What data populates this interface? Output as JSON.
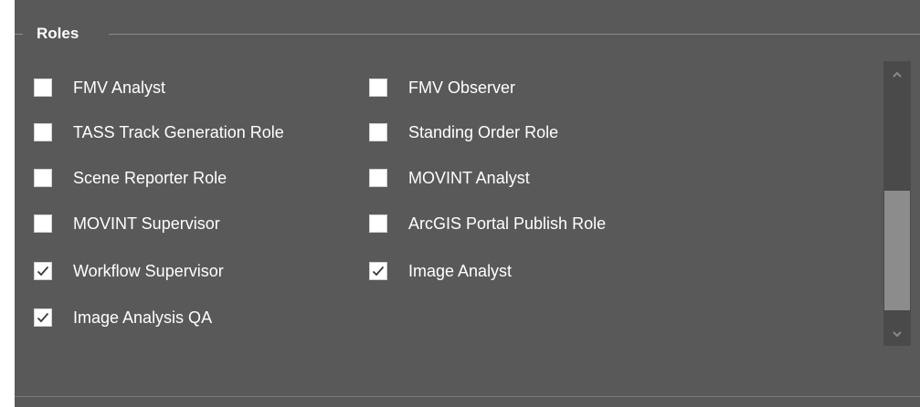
{
  "group": {
    "title": "Roles"
  },
  "roles": [
    {
      "label": "FMV Analyst",
      "checked": false
    },
    {
      "label": "FMV Observer",
      "checked": false
    },
    {
      "label": "TASS Track Generation Role",
      "checked": false
    },
    {
      "label": "Standing Order Role",
      "checked": false
    },
    {
      "label": "Scene Reporter Role",
      "checked": false
    },
    {
      "label": "MOVINT Analyst",
      "checked": false
    },
    {
      "label": "MOVINT Supervisor",
      "checked": false
    },
    {
      "label": "ArcGIS Portal Publish Role",
      "checked": false
    },
    {
      "label": "Workflow Supervisor",
      "checked": true
    },
    {
      "label": "Image Analyst",
      "checked": true
    },
    {
      "label": "Image Analysis QA",
      "checked": true
    }
  ],
  "scrollbar": {
    "position_fraction": 0.62,
    "up_icon": "chevron-up-icon",
    "down_icon": "chevron-down-icon"
  },
  "colors": {
    "panel_background": "#595959",
    "text": "#ffffff",
    "scroll_thumb": "#8c8c8c"
  }
}
